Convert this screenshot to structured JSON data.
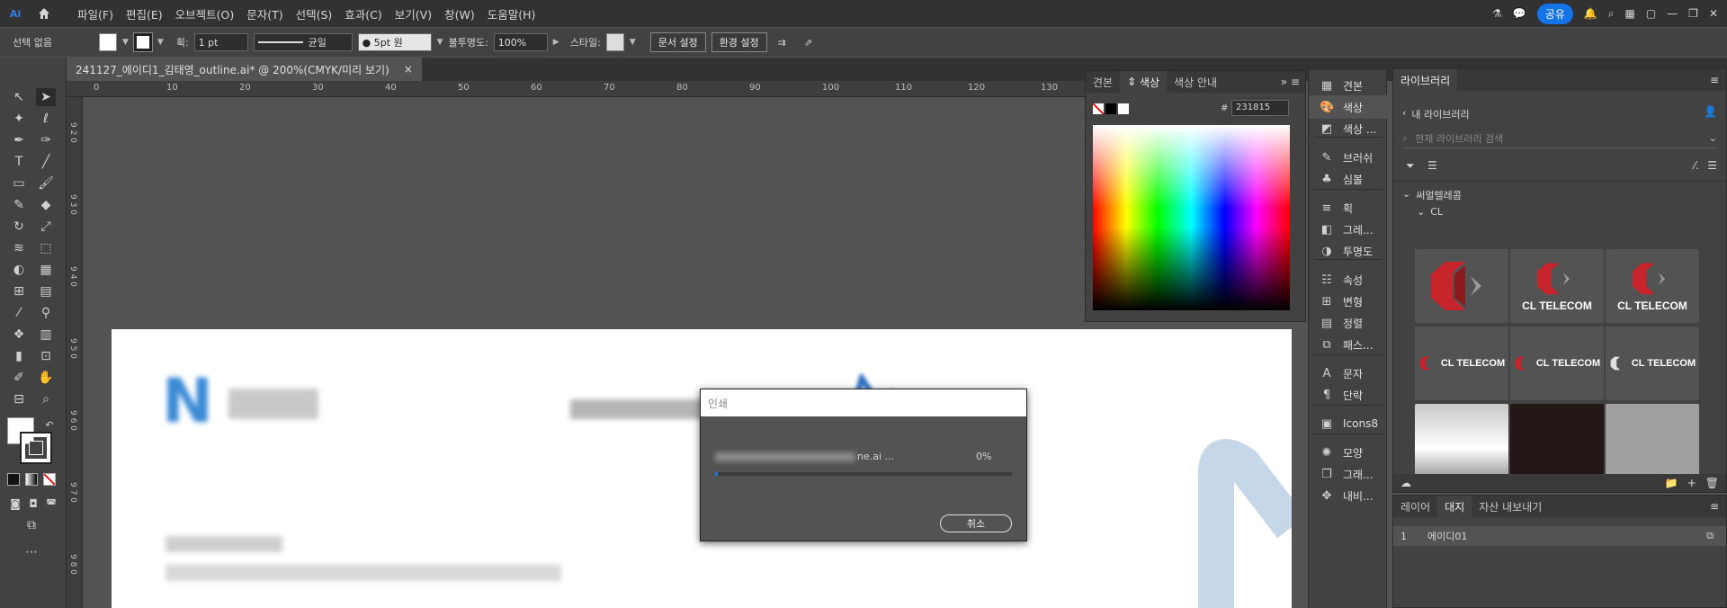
{
  "app": {
    "logo": "Ai"
  },
  "menu": [
    "파일(F)",
    "편집(E)",
    "오브젝트(O)",
    "문자(T)",
    "선택(S)",
    "효과(C)",
    "보기(V)",
    "창(W)",
    "도움말(H)"
  ],
  "share_label": "공유",
  "control": {
    "selection": "선택 없음",
    "stroke_label": "획:",
    "stroke_value": "1 pt",
    "profile": "균일",
    "brush": "5pt 원",
    "opacity_label": "불투명도:",
    "opacity_value": "100%",
    "style_label": "스타일:",
    "doc_setup": "문서 설정",
    "prefs": "환경 설정"
  },
  "document_tab": {
    "title": "241127_에이디1_김태영_outline.ai* @ 200%(CMYK/미리 보기)",
    "close": "×"
  },
  "ruler_h": [
    "0",
    "10",
    "20",
    "30",
    "40",
    "50",
    "60",
    "70",
    "80",
    "90",
    "100",
    "110",
    "120",
    "130"
  ],
  "ruler_v": [
    "9 2 0",
    "9 3 0",
    "9 4 0",
    "9 5 0",
    "9 6 0",
    "9 7 0",
    "9 8 0"
  ],
  "color_panel": {
    "tabs": [
      "견본",
      "색상",
      "색상 안내"
    ],
    "hex_label": "#",
    "hex": "231815"
  },
  "dock_items": [
    {
      "label": "견본",
      "icon": "grid-icon"
    },
    {
      "label": "색상",
      "icon": "palette-icon"
    },
    {
      "label": "색상 ...",
      "icon": "color-guide-icon"
    },
    {
      "label": "브러쉬",
      "icon": "brush-icon"
    },
    {
      "label": "심볼",
      "icon": "club-icon"
    },
    {
      "label": "획",
      "icon": "stroke-icon"
    },
    {
      "label": "그레...",
      "icon": "gradient-icon"
    },
    {
      "label": "투명도",
      "icon": "transparency-icon"
    },
    {
      "label": "속성",
      "icon": "properties-icon"
    },
    {
      "label": "변형",
      "icon": "transform-icon"
    },
    {
      "label": "정렬",
      "icon": "align-icon"
    },
    {
      "label": "패스...",
      "icon": "pathfinder-icon"
    },
    {
      "label": "문자",
      "icon": "character-icon"
    },
    {
      "label": "단락",
      "icon": "paragraph-icon"
    },
    {
      "label": "Icons8",
      "icon": "icons8-icon"
    },
    {
      "label": "모양",
      "icon": "appearance-icon"
    },
    {
      "label": "그래...",
      "icon": "graphic-styles-icon"
    },
    {
      "label": "내비...",
      "icon": "navigator-icon"
    }
  ],
  "library": {
    "tab": "라이브러리",
    "back": "내 라이브러리",
    "search_placeholder": "현재 라이브러리 검색",
    "group": "써멀텔레콤",
    "subgroup": "CL",
    "brand_text": "CL TELECOM"
  },
  "layers": {
    "tabs": [
      "레이어",
      "대지",
      "자산 내보내기"
    ],
    "rows": [
      {
        "num": "1",
        "name": "에이디01"
      }
    ]
  },
  "print_dialog": {
    "title": "인쇄",
    "file": "ne.ai ...",
    "percent": "0%",
    "progress": 0.01,
    "cancel": "취소"
  },
  "colors": {
    "accent": "#1473e6",
    "brand_red": "#d0262c"
  }
}
